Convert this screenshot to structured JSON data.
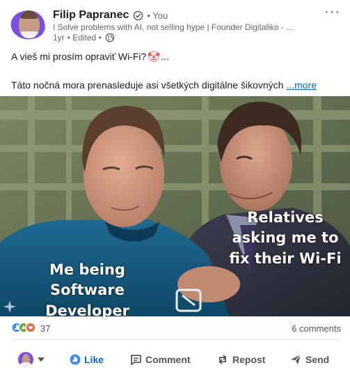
{
  "post": {
    "author_name": "Filip Papranec",
    "you_label": "• You",
    "headline": "I Solve problems with AI, not selling hype | Founder Digitaliko - ...",
    "age": "1yr",
    "edited": "• Edited •",
    "menu": "···",
    "text_line1_before": "A vieš mi prosím opraviť Wi-Fi?",
    "text_line1_after": "...",
    "text_line2": "Táto nočná mora prenasleduje asi všetkých digitálne šikovných",
    "more_link": "...more"
  },
  "meme": {
    "caption_left": "Me being Software Developer",
    "caption_right": "Relatives asking me to fix their Wi-Fi"
  },
  "stats": {
    "reaction_count": "37",
    "comments": "6 comments"
  },
  "actions": {
    "like": "Like",
    "comment": "Comment",
    "repost": "Repost",
    "send": "Send"
  },
  "colors": {
    "accent": "#0a66c2",
    "muted": "#666666",
    "avatar_bg": "#7d4fe0"
  },
  "icons": [
    "verified-icon",
    "globe-icon",
    "clown-emoji-icon",
    "reactions-icon",
    "like-icon",
    "comment-icon",
    "repost-icon",
    "send-icon",
    "chevron-down-icon"
  ]
}
